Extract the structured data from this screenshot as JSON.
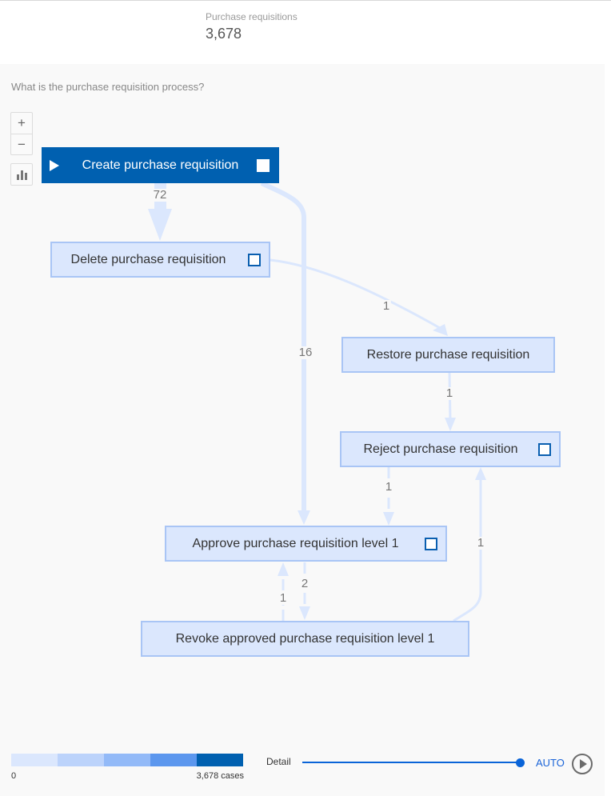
{
  "kpi": {
    "label": "Purchase requisitions",
    "value": "3,678"
  },
  "question": "What is the purchase requisition process?",
  "controls": {
    "zoom_in": "+",
    "zoom_out": "−",
    "stats_icon": "bar-chart-icon"
  },
  "nodes": [
    {
      "id": "create",
      "label": "Create purchase requisition",
      "start": true,
      "checkbox": true
    },
    {
      "id": "delete",
      "label": "Delete purchase requisition",
      "checkbox": true
    },
    {
      "id": "restore",
      "label": "Restore purchase requisition",
      "checkbox": false
    },
    {
      "id": "reject",
      "label": "Reject purchase requisition",
      "checkbox": true
    },
    {
      "id": "approve",
      "label": "Approve purchase requisition level 1",
      "checkbox": true
    },
    {
      "id": "revoke",
      "label": "Revoke approved purchase requisition level 1",
      "checkbox": false
    }
  ],
  "edges": [
    {
      "from": "create",
      "to": "delete",
      "count": "72"
    },
    {
      "from": "create",
      "to": "approve",
      "count": "16"
    },
    {
      "from": "delete",
      "to": "restore",
      "count": "1"
    },
    {
      "from": "restore",
      "to": "reject",
      "count": "1"
    },
    {
      "from": "reject",
      "to": "approve",
      "count": "1"
    },
    {
      "from": "revoke",
      "to": "reject",
      "count": "1"
    },
    {
      "from": "revoke",
      "to": "approve",
      "count": "1"
    },
    {
      "from": "approve",
      "to": "revoke",
      "count": "2"
    }
  ],
  "legend": {
    "min": "0",
    "max": "3,678 cases",
    "colors": [
      "#dbe7fd",
      "#bcd3fb",
      "#93baf8",
      "#5c97ee",
      "#0060b0"
    ]
  },
  "footer": {
    "detail_label": "Detail",
    "detail_level": 1.0,
    "auto_label": "AUTO"
  },
  "colors": {
    "accent": "#0060b0",
    "edge": "#dbe7fd",
    "slider": "#0a64d8"
  }
}
